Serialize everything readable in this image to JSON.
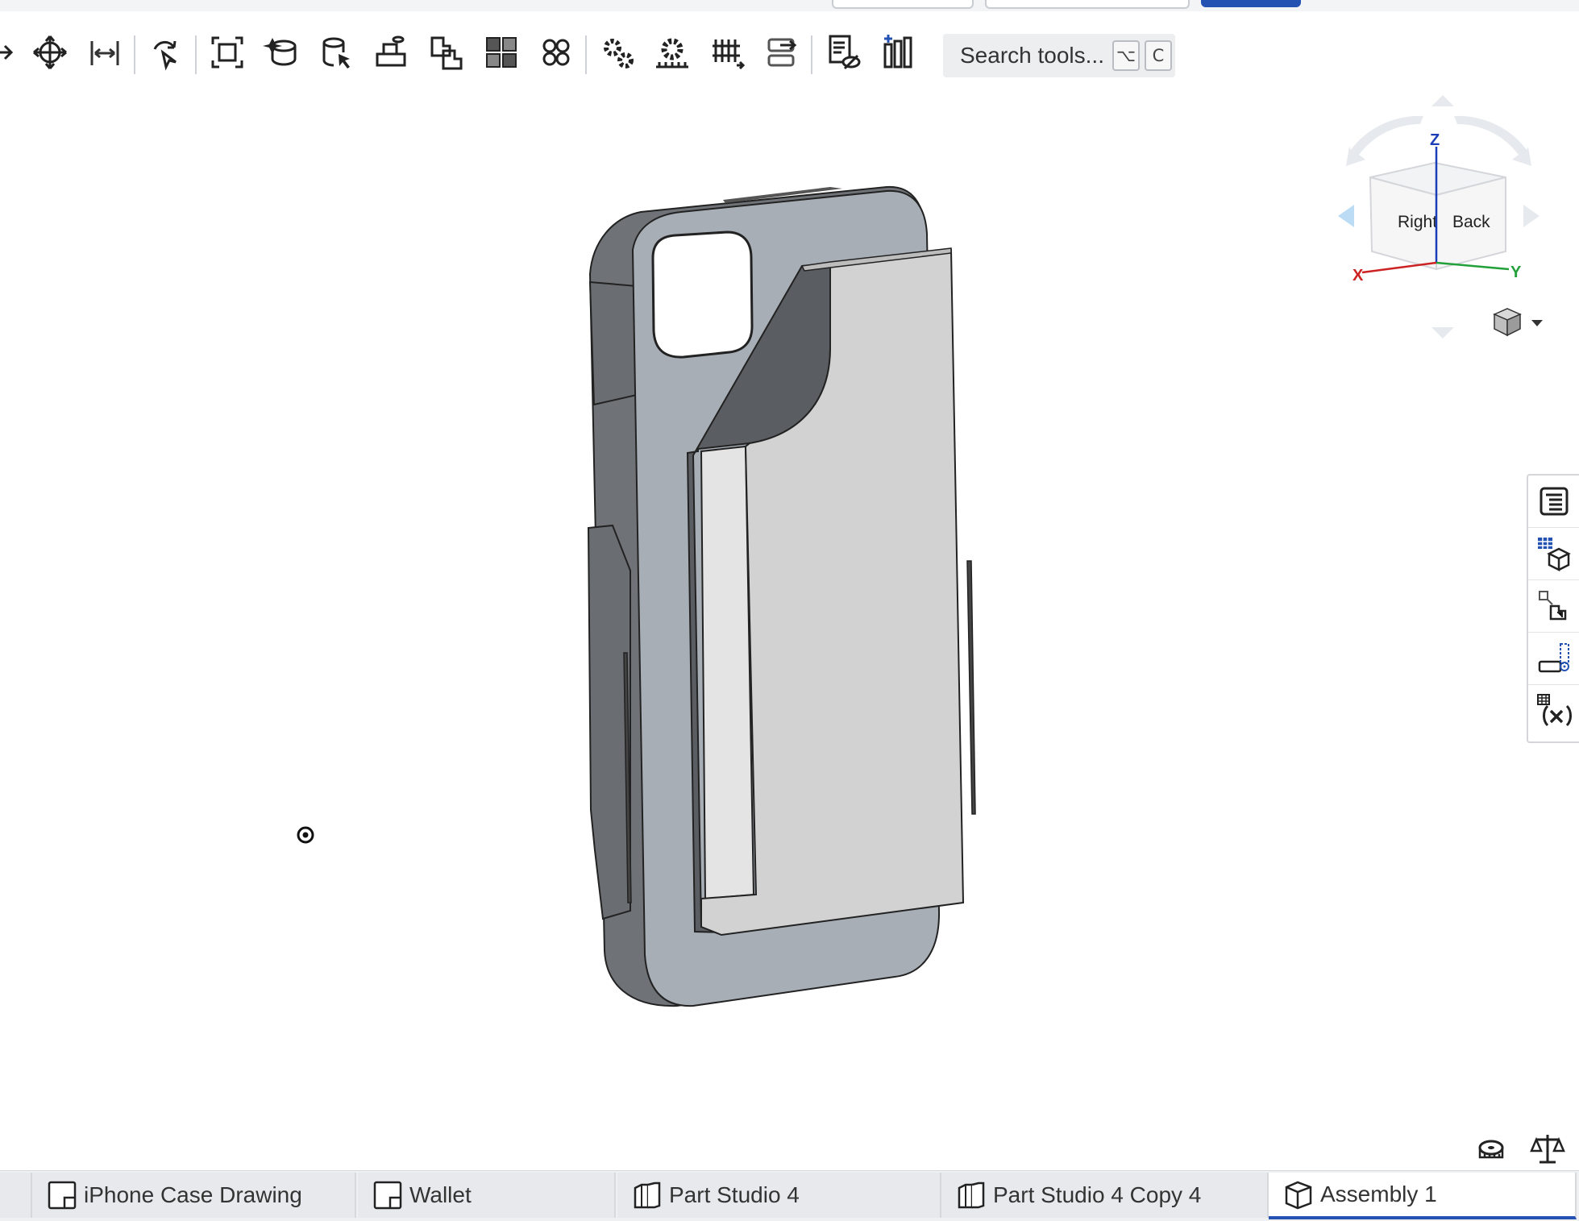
{
  "toolbar": {
    "icons": [
      "pan-icon",
      "move-icon",
      "mirror-icon",
      "rotate-icon",
      "fit-icon",
      "insert-icon",
      "select-part-icon",
      "mate-connector-icon",
      "replicate-icon",
      "pattern-icon",
      "group-icon",
      "gear-relation-icon",
      "rack-relation-icon",
      "screw-relation-icon",
      "linear-relation-icon",
      "named-views-icon",
      "explode-icon"
    ],
    "search_label": "Search tools...",
    "shortcut_keys": [
      "⌥",
      "C"
    ]
  },
  "viewcube": {
    "face_right": "Right",
    "face_back": "Back",
    "axis_x": "X",
    "axis_y": "Y",
    "axis_z": "Z"
  },
  "side_panel": {
    "icons": [
      "instance-list-icon",
      "bom-table-icon",
      "mate-features-icon",
      "configurations-icon",
      "variables-icon"
    ]
  },
  "bottom_tools": {
    "icons": [
      "measure-icon",
      "mass-properties-icon"
    ]
  },
  "tabs": [
    {
      "label": "iPhone Case Drawing",
      "icon": "drawing-icon",
      "active": false
    },
    {
      "label": "Wallet",
      "icon": "drawing-icon",
      "active": false
    },
    {
      "label": "Part Studio 4",
      "icon": "part-studio-icon",
      "active": false
    },
    {
      "label": "Part Studio 4 Copy 4",
      "icon": "part-studio-icon",
      "active": false
    },
    {
      "label": "Assembly 1",
      "icon": "assembly-icon",
      "active": true
    }
  ],
  "colors": {
    "accent": "#2452b3",
    "part_face": "#a7aeb6",
    "part_side": "#6f7276",
    "wallet_face": "#d2d2d2"
  }
}
